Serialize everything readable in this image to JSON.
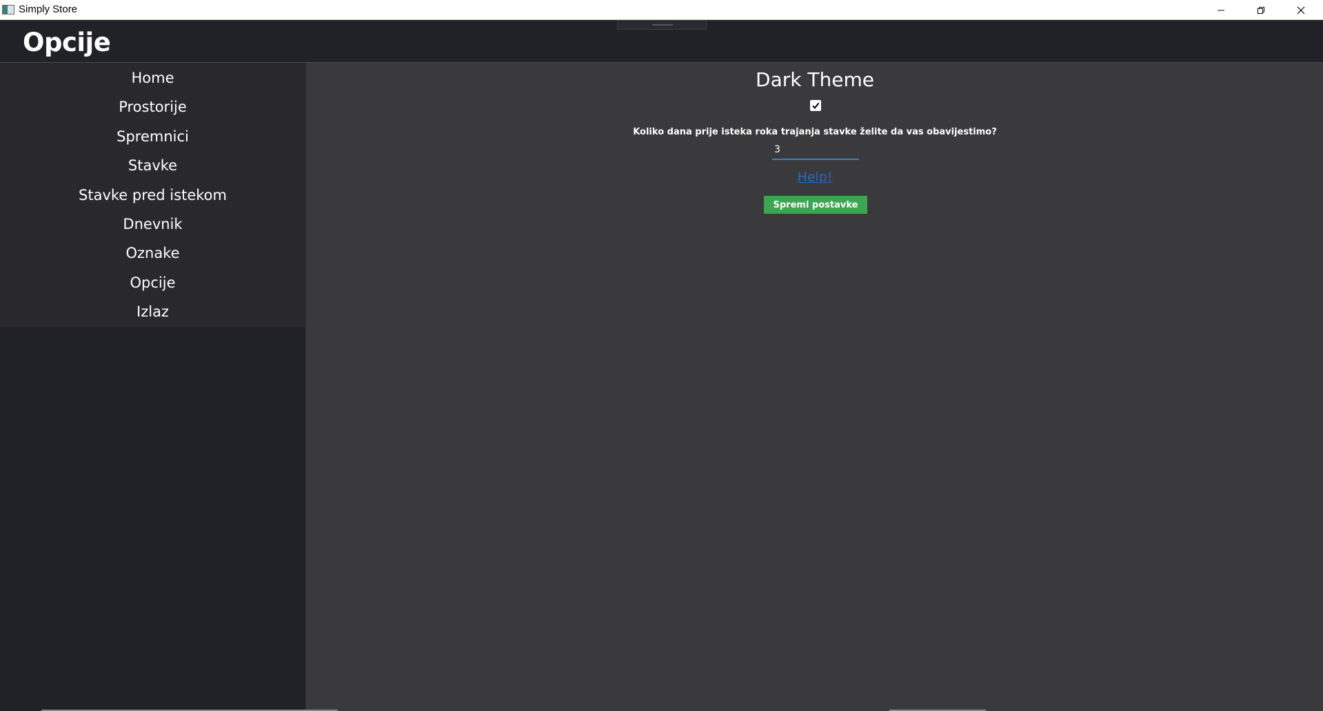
{
  "window": {
    "title": "Simply Store",
    "controls": [
      "minimize-icon",
      "restore-icon",
      "close-icon"
    ]
  },
  "header": {
    "title": "Opcije"
  },
  "sidebar": {
    "items": [
      {
        "label": "Home"
      },
      {
        "label": "Prostorije"
      },
      {
        "label": "Spremnici"
      },
      {
        "label": "Stavke"
      },
      {
        "label": "Stavke pred istekom"
      },
      {
        "label": "Dnevnik"
      },
      {
        "label": "Oznake"
      },
      {
        "label": "Opcije"
      },
      {
        "label": "Izlaz"
      }
    ]
  },
  "settings": {
    "theme_label": "Dark Theme",
    "dark_theme_checked": true,
    "notify_question": "Koliko dana prije isteka roka trajanja stavke želite da vas obavijestimo?",
    "notify_days": "3",
    "help_link": "Help!",
    "save_button": "Spremi postavke"
  },
  "colors": {
    "header_bg": "#212227",
    "sidebar_bg": "#29292b",
    "content_bg": "#3a3a3c",
    "accent_link": "#1f6cc0",
    "save_button_bg": "#3ca552",
    "input_underline": "#3f7fbf"
  }
}
